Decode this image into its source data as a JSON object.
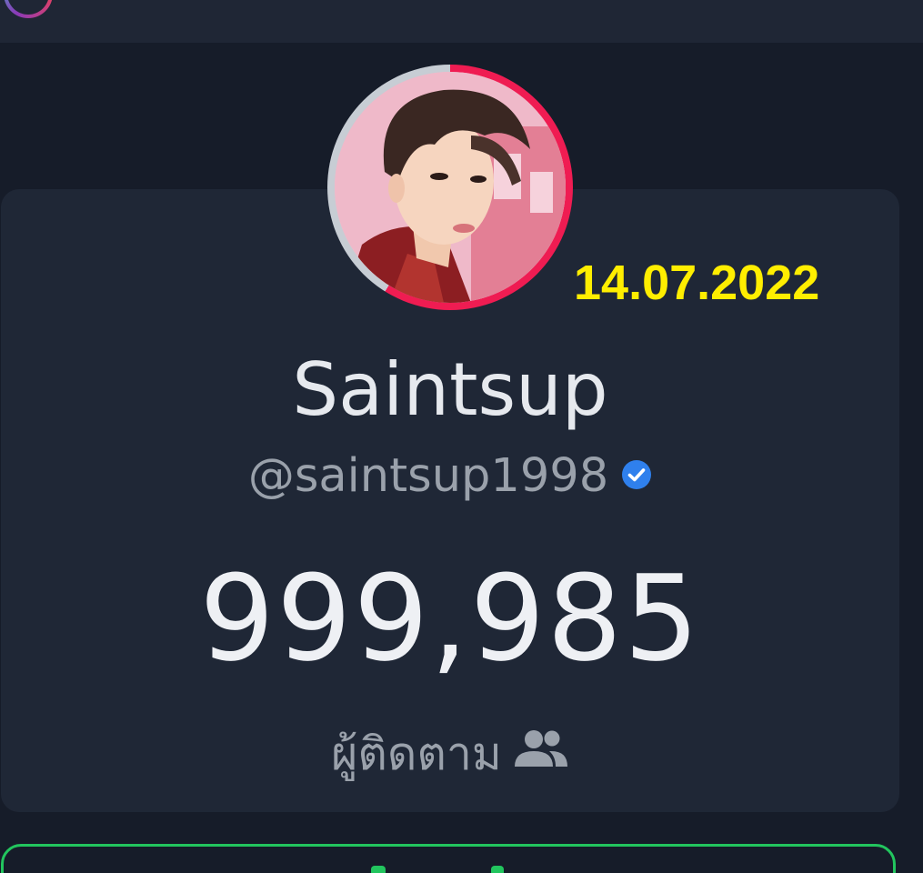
{
  "profile": {
    "display_name": "Saintsup",
    "handle": "@saintsup1998",
    "verified": true,
    "follower_count": "999,985",
    "follower_label": "ผู้ติดตาม"
  },
  "overlay": {
    "date": "14.07.2022",
    "date_color": "#ffee00"
  },
  "icons": {
    "verified": "verified-check-icon",
    "followers": "users-icon",
    "logo": "app-logo-icon"
  },
  "colors": {
    "background": "#161c29",
    "card": "#1f2736",
    "ring_accent": "#ef1c52",
    "button_border": "#22c55e",
    "verified_blue": "#2f80ed"
  }
}
